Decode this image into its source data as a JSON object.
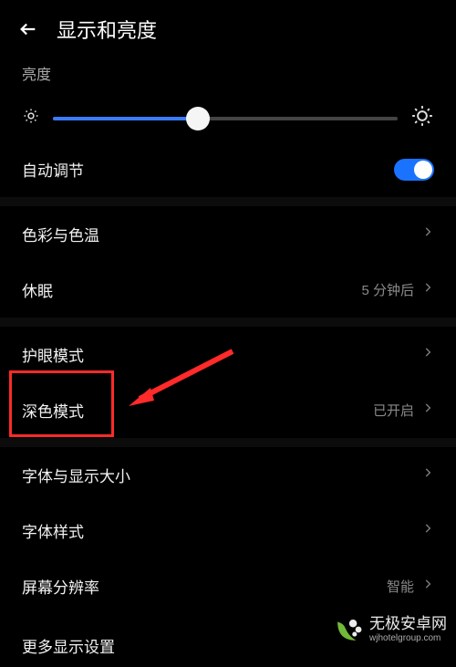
{
  "header": {
    "title": "显示和亮度"
  },
  "brightness": {
    "label": "亮度",
    "value_percent": 42,
    "auto_label": "自动调节",
    "auto_on": true
  },
  "groups": [
    {
      "rows": [
        {
          "label": "色彩与色温",
          "value": ""
        },
        {
          "label": "休眠",
          "value": "5 分钟后"
        }
      ]
    },
    {
      "rows": [
        {
          "label": "护眼模式",
          "value": ""
        },
        {
          "label": "深色模式",
          "value": "已开启"
        }
      ]
    },
    {
      "rows": [
        {
          "label": "字体与显示大小",
          "value": ""
        },
        {
          "label": "字体样式",
          "value": ""
        },
        {
          "label": "屏幕分辨率",
          "value": "智能"
        },
        {
          "label": "更多显示设置",
          "value": ""
        }
      ]
    }
  ],
  "watermark": {
    "title": "无极安卓网",
    "sub": "wjhotelgroup.com"
  }
}
